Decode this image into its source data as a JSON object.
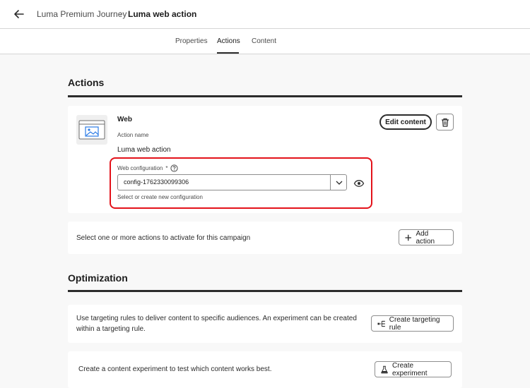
{
  "header": {
    "back_icon": "arrow-left-icon",
    "breadcrumb_parent": "Luma Premium Journey",
    "breadcrumb_separator": "›",
    "breadcrumb_current": "Luma web action"
  },
  "tabs": [
    {
      "label": "Properties",
      "active": false
    },
    {
      "label": "Actions",
      "active": true
    },
    {
      "label": "Content",
      "active": false
    }
  ],
  "actions_section": {
    "title": "Actions",
    "action_card": {
      "thumbnail_icon": "web-page-icon",
      "type_label": "Web",
      "action_name_label": "Action name",
      "action_name_value": "Luma web action",
      "edit_content_label": "Edit content",
      "delete_icon": "trash-icon",
      "web_configuration": {
        "label": "Web configuration",
        "required_marker": "*",
        "help_icon": "question-circle-icon",
        "value": "config-1762330099306",
        "dropdown_icon": "chevron-down-icon",
        "help_text": "Select or create new configuration",
        "preview_icon": "eye-icon",
        "highlight_color": "#e3121a"
      }
    },
    "add_action_card": {
      "text": "Select one or more actions to activate for this campaign",
      "button_label": "Add action",
      "button_icon": "plus-icon"
    }
  },
  "optimization_section": {
    "title": "Optimization",
    "targeting_card": {
      "text": "Use targeting rules to deliver content to specific audiences. An experiment can be created within a targeting rule.",
      "button_label": "Create targeting rule",
      "button_icon": "targeting-rule-icon"
    },
    "experiment_card": {
      "text": "Create a content experiment to test which content works best.",
      "button_label": "Create experiment",
      "button_icon": "beaker-icon"
    }
  }
}
